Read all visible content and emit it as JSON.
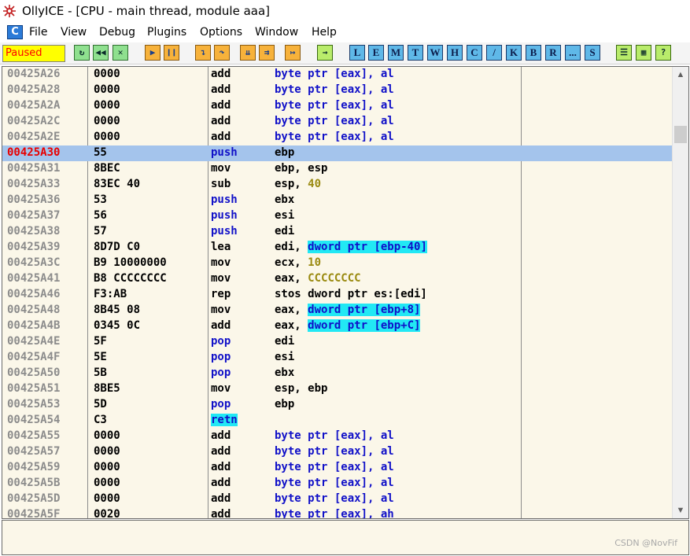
{
  "window": {
    "title": "OllyICE - [CPU - main thread, module aaa]"
  },
  "menu": {
    "logo": "C",
    "items": [
      "File",
      "View",
      "Debug",
      "Plugins",
      "Options",
      "Window",
      "Help"
    ]
  },
  "toolbar": {
    "status": "Paused",
    "letters": [
      "L",
      "E",
      "M",
      "T",
      "W",
      "H",
      "C",
      "/",
      "K",
      "B",
      "R",
      "...",
      "S"
    ]
  },
  "disasm": {
    "selected_index": 5,
    "rows": [
      {
        "addr": "00425A26",
        "hex": "0000",
        "op": "add",
        "args": [
          {
            "t": "byte ptr [eax], al",
            "s": "blue"
          }
        ]
      },
      {
        "addr": "00425A28",
        "hex": "0000",
        "op": "add",
        "args": [
          {
            "t": "byte ptr [eax], al",
            "s": "blue"
          }
        ]
      },
      {
        "addr": "00425A2A",
        "hex": "0000",
        "op": "add",
        "args": [
          {
            "t": "byte ptr [eax], al",
            "s": "blue"
          }
        ]
      },
      {
        "addr": "00425A2C",
        "hex": "0000",
        "op": "add",
        "args": [
          {
            "t": "byte ptr [eax], al",
            "s": "blue"
          }
        ]
      },
      {
        "addr": "00425A2E",
        "hex": "0000",
        "op": "add",
        "args": [
          {
            "t": "byte ptr [eax], al",
            "s": "blue"
          }
        ]
      },
      {
        "addr": "00425A30",
        "hex": "55",
        "op": "push",
        "op_style": "blue",
        "args": [
          {
            "t": "ebp",
            "s": "plain"
          }
        ]
      },
      {
        "addr": "00425A31",
        "hex": "8BEC",
        "op": "mov",
        "args": [
          {
            "t": "ebp, esp",
            "s": "plain"
          }
        ]
      },
      {
        "addr": "00425A33",
        "hex": "83EC 40",
        "op": "sub",
        "args": [
          {
            "t": "esp, ",
            "s": "plain"
          },
          {
            "t": "40",
            "s": "num"
          }
        ]
      },
      {
        "addr": "00425A36",
        "hex": "53",
        "op": "push",
        "op_style": "blue",
        "args": [
          {
            "t": "ebx",
            "s": "plain"
          }
        ]
      },
      {
        "addr": "00425A37",
        "hex": "56",
        "op": "push",
        "op_style": "blue",
        "args": [
          {
            "t": "esi",
            "s": "plain"
          }
        ]
      },
      {
        "addr": "00425A38",
        "hex": "57",
        "op": "push",
        "op_style": "blue",
        "args": [
          {
            "t": "edi",
            "s": "plain"
          }
        ]
      },
      {
        "addr": "00425A39",
        "hex": "8D7D C0",
        "op": "lea",
        "args": [
          {
            "t": "edi, ",
            "s": "plain"
          },
          {
            "t": "dword ptr [ebp-40]",
            "s": "hl"
          }
        ]
      },
      {
        "addr": "00425A3C",
        "hex": "B9 10000000",
        "op": "mov",
        "args": [
          {
            "t": "ecx, ",
            "s": "plain"
          },
          {
            "t": "10",
            "s": "num"
          }
        ]
      },
      {
        "addr": "00425A41",
        "hex": "B8 CCCCCCCC",
        "op": "mov",
        "args": [
          {
            "t": "eax, ",
            "s": "plain"
          },
          {
            "t": "CCCCCCCC",
            "s": "num"
          }
        ]
      },
      {
        "addr": "00425A46",
        "hex": "F3:AB",
        "op": "rep",
        "args": [
          {
            "t": "stos dword ptr es:[edi]",
            "s": "plain"
          }
        ]
      },
      {
        "addr": "00425A48",
        "hex": "8B45 08",
        "op": "mov",
        "args": [
          {
            "t": "eax, ",
            "s": "plain"
          },
          {
            "t": "dword ptr [ebp+8]",
            "s": "hl"
          }
        ]
      },
      {
        "addr": "00425A4B",
        "hex": "0345 0C",
        "op": "add",
        "args": [
          {
            "t": "eax, ",
            "s": "plain"
          },
          {
            "t": "dword ptr [ebp+C]",
            "s": "hl"
          }
        ]
      },
      {
        "addr": "00425A4E",
        "hex": "5F",
        "op": "pop",
        "op_style": "blue",
        "args": [
          {
            "t": "edi",
            "s": "plain"
          }
        ]
      },
      {
        "addr": "00425A4F",
        "hex": "5E",
        "op": "pop",
        "op_style": "blue",
        "args": [
          {
            "t": "esi",
            "s": "plain"
          }
        ]
      },
      {
        "addr": "00425A50",
        "hex": "5B",
        "op": "pop",
        "op_style": "blue",
        "args": [
          {
            "t": "ebx",
            "s": "plain"
          }
        ]
      },
      {
        "addr": "00425A51",
        "hex": "8BE5",
        "op": "mov",
        "args": [
          {
            "t": "esp, ebp",
            "s": "plain"
          }
        ]
      },
      {
        "addr": "00425A53",
        "hex": "5D",
        "op": "pop",
        "op_style": "blue",
        "args": [
          {
            "t": "ebp",
            "s": "plain"
          }
        ]
      },
      {
        "addr": "00425A54",
        "hex": "C3",
        "op": "retn",
        "op_style": "cyan",
        "args": []
      },
      {
        "addr": "00425A55",
        "hex": "0000",
        "op": "add",
        "args": [
          {
            "t": "byte ptr [eax], al",
            "s": "blue"
          }
        ]
      },
      {
        "addr": "00425A57",
        "hex": "0000",
        "op": "add",
        "args": [
          {
            "t": "byte ptr [eax], al",
            "s": "blue"
          }
        ]
      },
      {
        "addr": "00425A59",
        "hex": "0000",
        "op": "add",
        "args": [
          {
            "t": "byte ptr [eax], al",
            "s": "blue"
          }
        ]
      },
      {
        "addr": "00425A5B",
        "hex": "0000",
        "op": "add",
        "args": [
          {
            "t": "byte ptr [eax], al",
            "s": "blue"
          }
        ]
      },
      {
        "addr": "00425A5D",
        "hex": "0000",
        "op": "add",
        "args": [
          {
            "t": "byte ptr [eax], al",
            "s": "blue"
          }
        ]
      },
      {
        "addr": "00425A5F",
        "hex": "0020",
        "op": "add",
        "args": [
          {
            "t": "byte ptr [eax], ah",
            "s": "blue"
          }
        ]
      }
    ]
  },
  "watermark": "CSDN @NovFif",
  "colors": {
    "selected_row": "#a4c4ec",
    "highlight": "#22e8f4",
    "status_bg": "#ffff00",
    "status_text": "#ff0000",
    "pane_bg": "#fbf7e9"
  }
}
